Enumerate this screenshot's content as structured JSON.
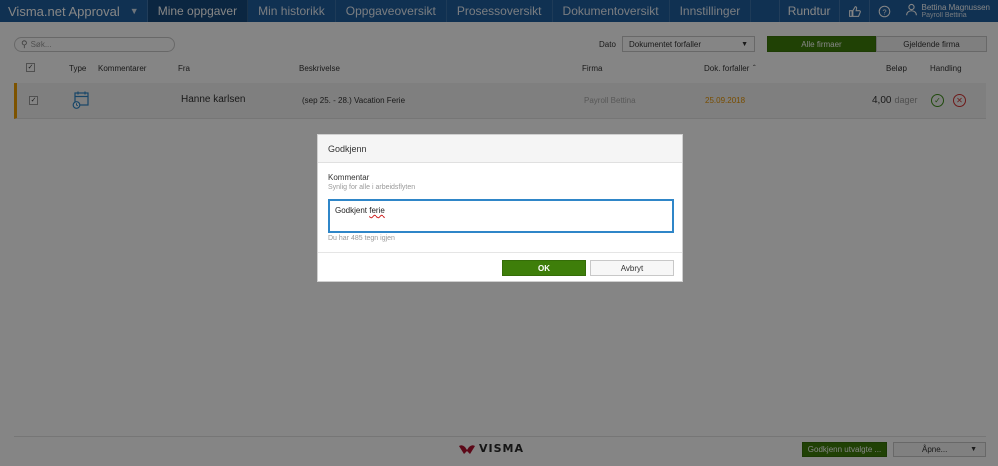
{
  "header": {
    "app_title": "Visma.net Approval",
    "nav": [
      {
        "label": "Mine oppgaver"
      },
      {
        "label": "Min historikk"
      },
      {
        "label": "Oppgaveoversikt"
      },
      {
        "label": "Prosessoversikt"
      },
      {
        "label": "Dokumentoversikt"
      },
      {
        "label": "Innstillinger"
      }
    ],
    "tour_label": "Rundtur",
    "user_name": "Bettina Magnussen",
    "user_company": "Payroll Bettina"
  },
  "toolbar": {
    "search_placeholder": "Søk...",
    "date_label": "Dato",
    "date_select_value": "Dokumentet forfaller",
    "seg_all": "Alle firmaer",
    "seg_current": "Gjeldende firma"
  },
  "table": {
    "headers": {
      "type": "Type",
      "comments": "Kommentarer",
      "from": "Fra",
      "description": "Beskrivelse",
      "company": "Firma",
      "due": "Dok. forfaller",
      "amount": "Beløp",
      "action": "Handling"
    },
    "rows": [
      {
        "from": "Hanne karlsen",
        "description": "(sep 25. - 28.) Vacation Ferie",
        "company": "Payroll Bettina",
        "due": "25.09.2018",
        "amount": "4,00",
        "unit": "dager"
      }
    ]
  },
  "modal": {
    "title": "Godkjenn",
    "comment_label": "Kommentar",
    "comment_sub": "Synlig for alle i arbeidsflyten",
    "comment_value_a": "Godkjent ",
    "comment_value_b": "ferie",
    "chars_left": "Du har 485 tegn igjen",
    "ok_label": "OK",
    "cancel_label": "Avbryt"
  },
  "footer": {
    "logo_text": "VISMA",
    "approve_selected": "Godkjenn utvalgte ...",
    "open_label": "Åpne..."
  },
  "colors": {
    "nav_bg": "#1f5f9e",
    "accent_green": "#3e7e0a",
    "due_orange": "#e69400",
    "focus_blue": "#2f86c8"
  }
}
